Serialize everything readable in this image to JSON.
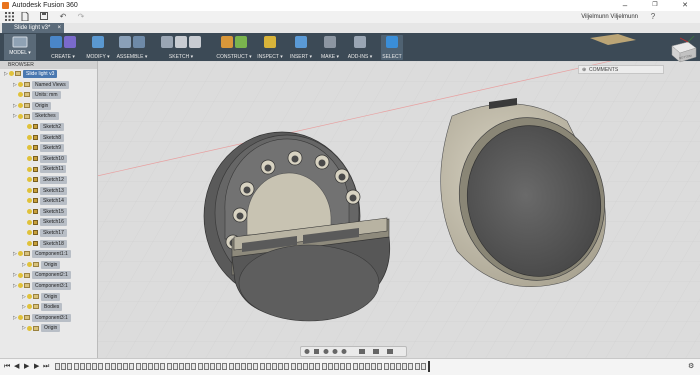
{
  "window": {
    "title": "Autodesk Fusion 360",
    "controls": [
      "–",
      "❐",
      "✕"
    ]
  },
  "quickbar": {
    "user": "Viljelmunn Viljelmunn",
    "icons": [
      "app-grid-icon",
      "file-icon",
      "save-icon",
      "undo-icon",
      "redo-icon"
    ]
  },
  "doc_tab": {
    "label": "Slide light v3*",
    "close": "×"
  },
  "ribbon": {
    "mode_button": "MODEL ▾",
    "groups": [
      {
        "label": "CREATE ▾",
        "colors": [
          "#4a86c8",
          "#7a6acb"
        ]
      },
      {
        "label": "MODIFY ▾",
        "colors": [
          "#5a98d0"
        ]
      },
      {
        "label": "ASSEMBLE ▾",
        "colors": [
          "#8aa0b8",
          "#6e8aa8"
        ]
      },
      {
        "label": "SKETCH ▾",
        "colors": [
          "#9aa6b4",
          "#c8ccd2"
        ]
      },
      {
        "label": "CONSTRUCT ▾",
        "colors": [
          "#d8973a",
          "#7ab44e"
        ]
      },
      {
        "label": "INSPECT ▾",
        "colors": [
          "#d9b43a"
        ]
      },
      {
        "label": "INSERT ▾",
        "colors": [
          "#5a9ad6"
        ]
      },
      {
        "label": "MAKE ▾",
        "colors": [
          "#8c96a2"
        ]
      },
      {
        "label": "ADD-INS ▾",
        "colors": [
          "#9aa6b4"
        ]
      },
      {
        "label": "SELECT ▾",
        "colors": [
          "#3a8ed8"
        ]
      }
    ]
  },
  "browser": {
    "header": "BROWSER",
    "nodes": [
      {
        "label": "Slide light v3",
        "indent": 0,
        "kind": "root",
        "selected": true
      },
      {
        "label": "Named Views",
        "indent": 1,
        "kind": "folder"
      },
      {
        "label": "Units: mm",
        "indent": 1,
        "kind": "plain"
      },
      {
        "label": "Origin",
        "indent": 1,
        "kind": "folder"
      },
      {
        "label": "Sketches",
        "indent": 1,
        "kind": "folder"
      },
      {
        "label": "Sketch2",
        "indent": 2,
        "kind": "sketch"
      },
      {
        "label": "Sketch8",
        "indent": 2,
        "kind": "sketch"
      },
      {
        "label": "Sketch9",
        "indent": 2,
        "kind": "sketch"
      },
      {
        "label": "Sketch10",
        "indent": 2,
        "kind": "sketch"
      },
      {
        "label": "Sketch11",
        "indent": 2,
        "kind": "sketch"
      },
      {
        "label": "Sketch12",
        "indent": 2,
        "kind": "sketch"
      },
      {
        "label": "Sketch13",
        "indent": 2,
        "kind": "sketch"
      },
      {
        "label": "Sketch14",
        "indent": 2,
        "kind": "sketch"
      },
      {
        "label": "Sketch15",
        "indent": 2,
        "kind": "sketch"
      },
      {
        "label": "Sketch16",
        "indent": 2,
        "kind": "sketch"
      },
      {
        "label": "Sketch17",
        "indent": 2,
        "kind": "sketch"
      },
      {
        "label": "Sketch18",
        "indent": 2,
        "kind": "sketch"
      },
      {
        "label": "Component1:1",
        "indent": 1,
        "kind": "component"
      },
      {
        "label": "Origin",
        "indent": 2,
        "kind": "folder"
      },
      {
        "label": "Component2:1",
        "indent": 1,
        "kind": "component"
      },
      {
        "label": "Component3:1",
        "indent": 1,
        "kind": "component"
      },
      {
        "label": "Origin",
        "indent": 2,
        "kind": "folder"
      },
      {
        "label": "Bodies",
        "indent": 2,
        "kind": "folder"
      },
      {
        "label": "Component3:1",
        "indent": 1,
        "kind": "component"
      },
      {
        "label": "Origin",
        "indent": 2,
        "kind": "folder"
      }
    ]
  },
  "comments": {
    "label": "COMMENTS"
  },
  "viewcube": {
    "face": "BOTTOM"
  },
  "colors": {
    "ribbon_bg": "#3c4a56",
    "tab_bg": "#5b6b7a",
    "selection": "#4a78b0"
  }
}
